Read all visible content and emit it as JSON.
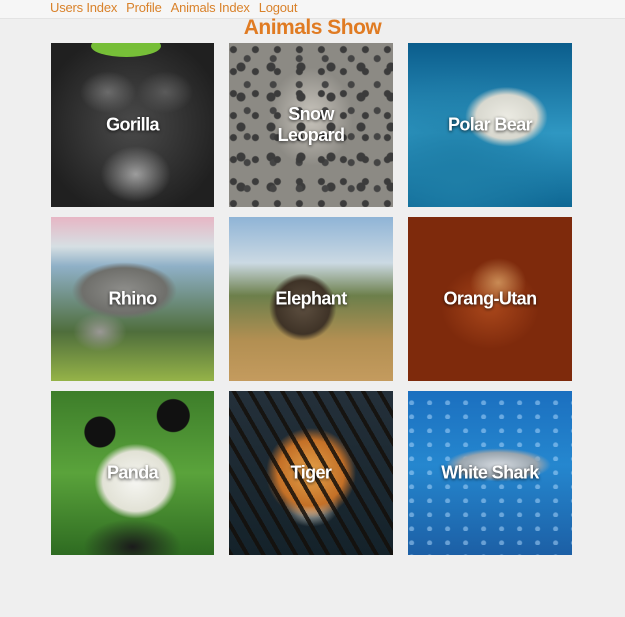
{
  "nav": {
    "items": [
      {
        "label": "Users Index"
      },
      {
        "label": "Profile"
      },
      {
        "label": "Animals Index"
      },
      {
        "label": "Logout"
      }
    ]
  },
  "page": {
    "title": "Animals Show"
  },
  "animals": [
    {
      "name": "Gorilla"
    },
    {
      "name": "Snow Leopard"
    },
    {
      "name": "Polar Bear"
    },
    {
      "name": "Rhino"
    },
    {
      "name": "Elephant"
    },
    {
      "name": "Orang-Utan"
    },
    {
      "name": "Panda"
    },
    {
      "name": "Tiger"
    },
    {
      "name": "White Shark"
    }
  ],
  "colors": {
    "accent": "#e07b22",
    "nav_link": "#d9822b",
    "background": "#efefef",
    "label_text": "#ffffff"
  }
}
